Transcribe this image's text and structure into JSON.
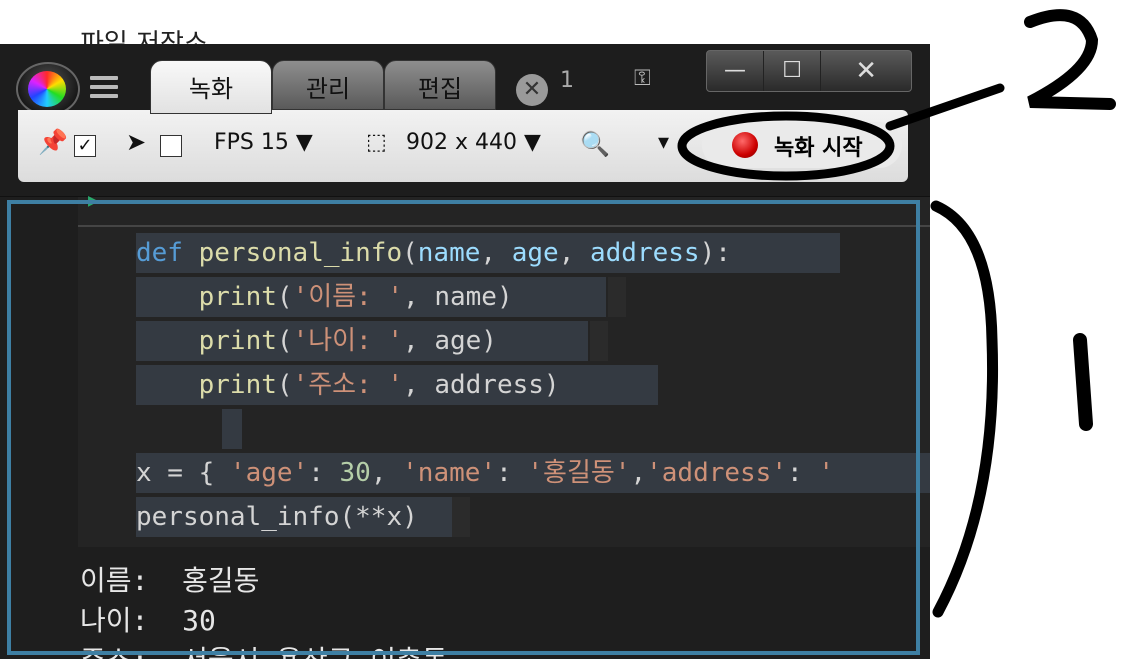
{
  "background_title": "파일 저장소",
  "app": {
    "tabs": [
      {
        "label": "녹화",
        "active": true
      },
      {
        "label": "관리",
        "active": false
      },
      {
        "label": "편집",
        "active": false
      }
    ],
    "close_badge": "✕",
    "tab_count": "1",
    "window_buttons": [
      "—",
      "☐",
      "✕"
    ]
  },
  "toolbar": {
    "pin_checked": true,
    "cursor_checked": false,
    "fps_label": "FPS 15",
    "size_label": "902 x 440",
    "record_button": "녹화 시작"
  },
  "code": {
    "lines": [
      "def personal_info(name, age, address):",
      "    print('이름: ', name)",
      "    print('나이: ', age)",
      "    print('주소: ', address)",
      "",
      "x = { 'age': 30, 'name': '홍길동','address': '",
      "personal_info(**x)"
    ]
  },
  "output": {
    "lines": [
      "이름:  홍길동",
      "나이:  30",
      "주소:  서울시 용산구 이촌동"
    ]
  },
  "annotations": {
    "label_1": "1",
    "label_2": "2"
  },
  "colors": {
    "keyword": "#569cd6",
    "function": "#dcdcaa",
    "param": "#9cdcfe",
    "string": "#ce9178",
    "number": "#b5cea8",
    "highlight_box": "#3e7fa3",
    "record_dot": "#cc0000"
  }
}
